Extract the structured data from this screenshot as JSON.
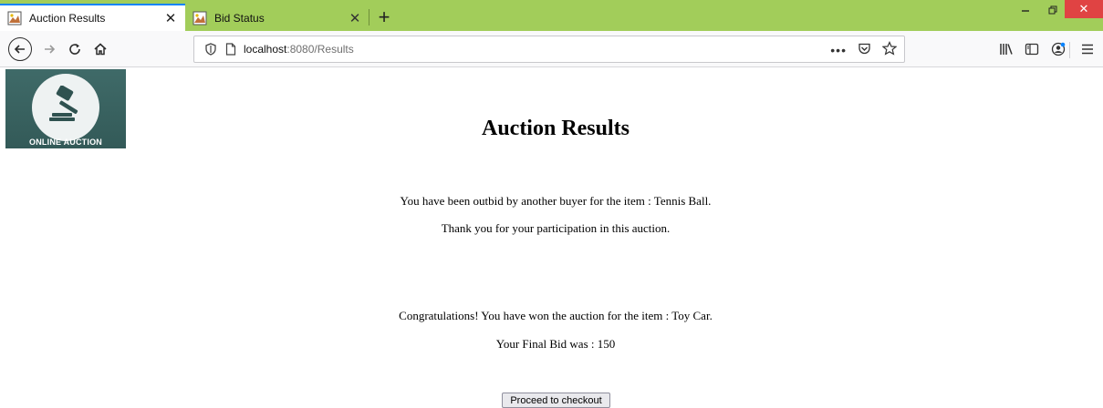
{
  "browser": {
    "tabs": [
      {
        "title": "Auction Results",
        "active": true
      },
      {
        "title": "Bid Status",
        "active": false
      }
    ],
    "new_tab_label": "+",
    "url_host": "localhost",
    "url_rest": ":8080/Results",
    "accent_color": "#a2cd5a"
  },
  "logo": {
    "text": "ONLINE AUCTION",
    "icon": "gavel-icon"
  },
  "page": {
    "title": "Auction Results",
    "outbid_message": "You have been outbid by another buyer for the item : Tennis Ball.",
    "thanks_message": "Thank you for your participation in this auction.",
    "win_message": "Congratulations! You have won the auction for the item : Toy Car.",
    "final_bid_message": "Your Final Bid was : 150",
    "checkout_label": "Proceed to checkout"
  }
}
